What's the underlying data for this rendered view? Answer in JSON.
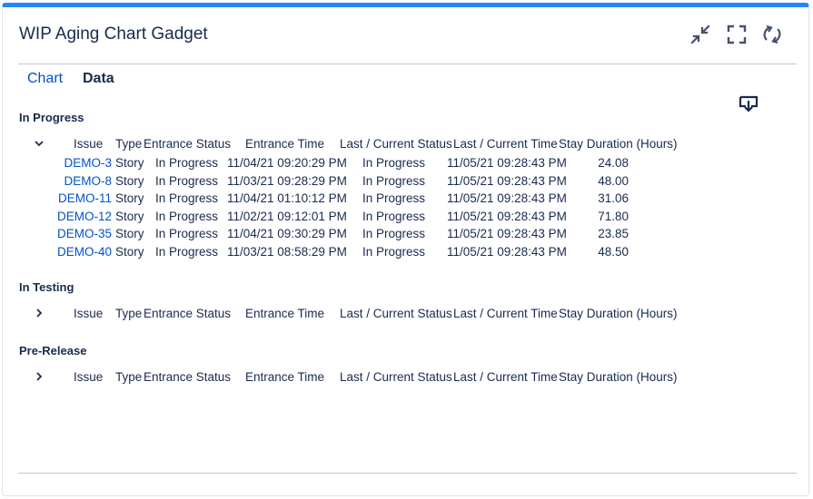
{
  "gadget": {
    "title": "WIP Aging Chart Gadget"
  },
  "tabs": {
    "chart": "Chart",
    "data": "Data"
  },
  "icons": {
    "minimize": "minimize-icon",
    "fullscreen": "fullscreen-icon",
    "refresh": "refresh-icon",
    "download": "download-icon",
    "chevron_down": "chevron-down-icon",
    "chevron_right": "chevron-right-icon"
  },
  "colors": {
    "accent": "#2684ff",
    "link": "#0052cc",
    "text": "#172b4d"
  },
  "columns": [
    "Issue",
    "Type",
    "Entrance Status",
    "Entrance Time",
    "Last / Current Status",
    "Last / Current Time",
    "Stay Duration (Hours)"
  ],
  "sections": [
    {
      "title": "In Progress",
      "expanded": true,
      "rows": [
        {
          "issue": "DEMO-3",
          "type": "Story",
          "entrance_status": "In Progress",
          "entrance_time": "11/04/21 09:20:29 PM",
          "last_status": "In Progress",
          "last_time": "11/05/21 09:28:43 PM",
          "duration": "24.08"
        },
        {
          "issue": "DEMO-8",
          "type": "Story",
          "entrance_status": "In Progress",
          "entrance_time": "11/03/21 09:28:29 PM",
          "last_status": "In Progress",
          "last_time": "11/05/21 09:28:43 PM",
          "duration": "48.00"
        },
        {
          "issue": "DEMO-11",
          "type": "Story",
          "entrance_status": "In Progress",
          "entrance_time": "11/04/21 01:10:12 PM",
          "last_status": "In Progress",
          "last_time": "11/05/21 09:28:43 PM",
          "duration": "31.06"
        },
        {
          "issue": "DEMO-12",
          "type": "Story",
          "entrance_status": "In Progress",
          "entrance_time": "11/02/21 09:12:01 PM",
          "last_status": "In Progress",
          "last_time": "11/05/21 09:28:43 PM",
          "duration": "71.80"
        },
        {
          "issue": "DEMO-35",
          "type": "Story",
          "entrance_status": "In Progress",
          "entrance_time": "11/04/21 09:30:29 PM",
          "last_status": "In Progress",
          "last_time": "11/05/21 09:28:43 PM",
          "duration": "23.85"
        },
        {
          "issue": "DEMO-40",
          "type": "Story",
          "entrance_status": "In Progress",
          "entrance_time": "11/03/21 08:58:29 PM",
          "last_status": "In Progress",
          "last_time": "11/05/21 09:28:43 PM",
          "duration": "48.50"
        }
      ]
    },
    {
      "title": "In Testing",
      "expanded": false,
      "rows": []
    },
    {
      "title": "Pre-Release",
      "expanded": false,
      "rows": []
    }
  ]
}
